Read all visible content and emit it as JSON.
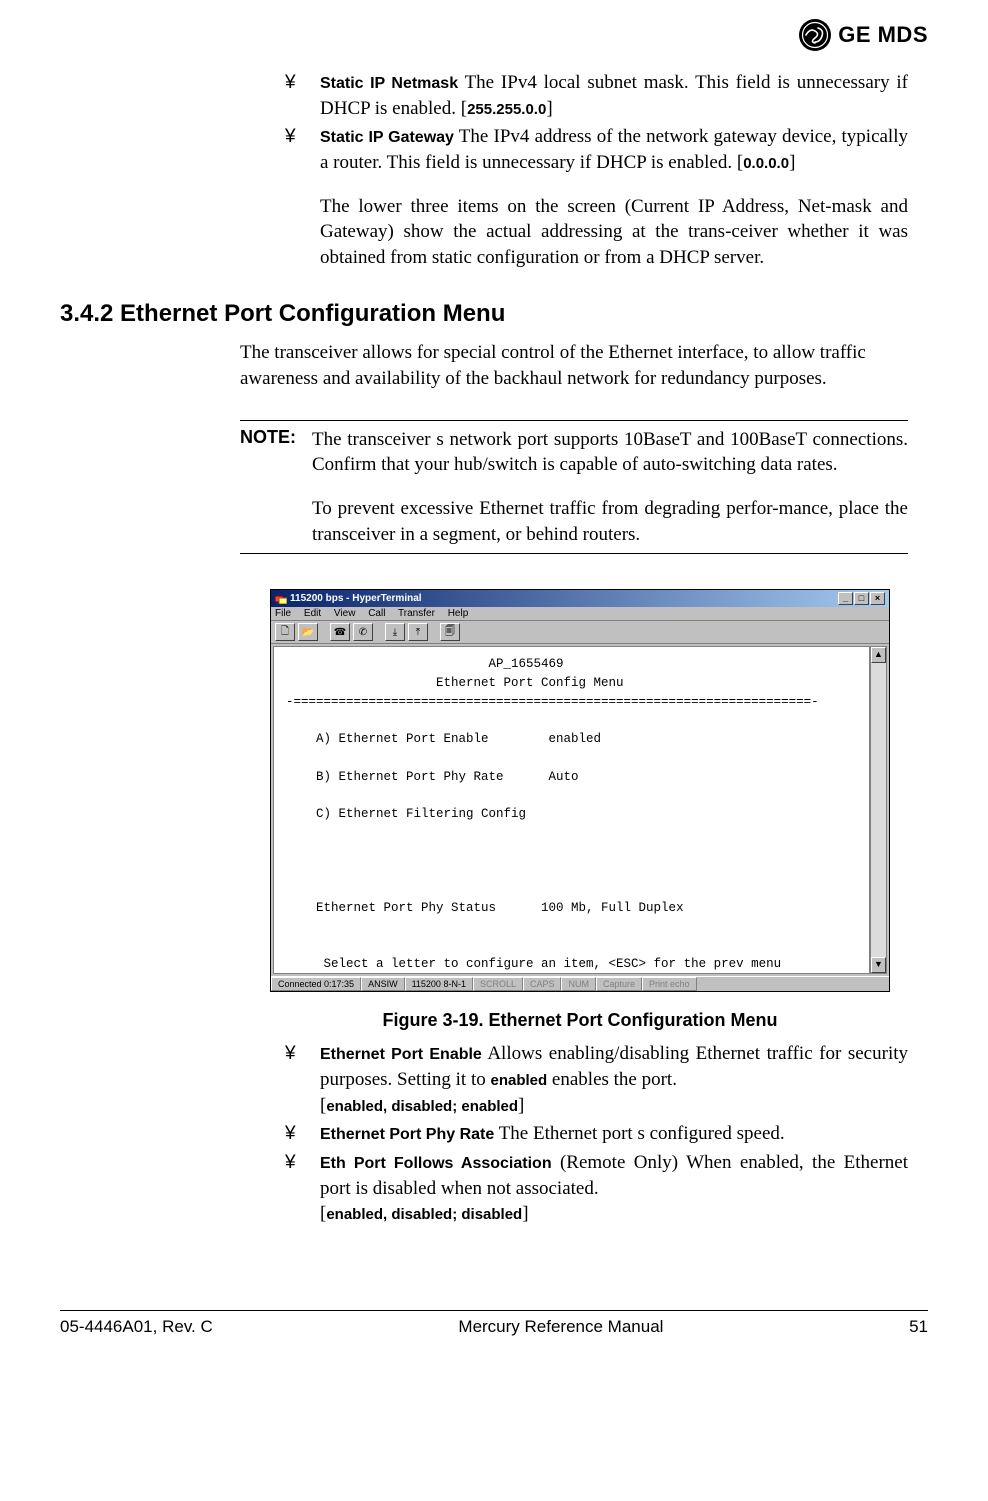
{
  "brand": {
    "name": "GE MDS"
  },
  "bullets_top": [
    {
      "term": "Static IP Netmask",
      "desc_a": "The IPv4 local subnet mask. This field is unnecessary if DHCP is enabled. [",
      "val": "255.255.0.0",
      "desc_b": "]"
    },
    {
      "term": "Static IP Gateway",
      "desc_a": "The IPv4 address of the network gateway device, typically a router. This field is unnecessary if DHCP is enabled. [",
      "val": "0.0.0.0",
      "desc_b": "]"
    }
  ],
  "follow_para": "The lower three items on the screen (Current IP Address, Net-mask and Gateway) show the actual addressing at the trans-ceiver whether it was obtained from static configuration or from a DHCP server.",
  "section_heading": "3.4.2 Ethernet Port Configuration Menu",
  "section_para": "The transceiver allows for special control of the Ethernet interface, to allow traffic awareness and availability of the backhaul network for redundancy purposes.",
  "note": {
    "label": "NOTE:",
    "p1": "The transceiver s network port supports 10BaseT and 100BaseT connections. Confirm that your hub/switch is capable of auto-switching data rates.",
    "p2": "To prevent excessive Ethernet traffic from degrading perfor-mance, place the transceiver in a segment, or behind routers."
  },
  "hyperterminal": {
    "title": "115200 bps - HyperTerminal",
    "menu": {
      "file": "File",
      "edit": "Edit",
      "view": "View",
      "call": "Call",
      "transfer": "Transfer",
      "help": "Help"
    },
    "terminal": {
      "header1": "                           AP_1655469",
      "header2": "                    Ethernet Port Config Menu",
      "divider": "-=====================================================================-",
      "blank": " ",
      "rowA": "    A) Ethernet Port Enable        enabled",
      "rowB": "    B) Ethernet Port Phy Rate      Auto",
      "rowC": "    C) Ethernet Filtering Config",
      "phy": "    Ethernet Port Phy Status      100 Mb, Full Duplex",
      "prompt": "     Select a letter to configure an item, <ESC> for the prev menu"
    },
    "status": {
      "conn": "Connected 0:17:35",
      "emul": "ANSIW",
      "rate": "115200 8-N-1",
      "scroll": "SCROLL",
      "caps": "CAPS",
      "num": "NUM",
      "capture": "Capture",
      "echo": "Print echo"
    }
  },
  "figure_caption": "Figure 3-19. Ethernet Port Configuration Menu",
  "bullets_bottom": [
    {
      "term": "Ethernet Port Enable",
      "desc": "Allows enabling/disabling Ethernet traffic for security purposes. Setting it to ",
      "inline_term": "enabled",
      "desc2": " enables the port.",
      "opts": "[enabled, disabled; enabled]"
    },
    {
      "term": "Ethernet Port Phy Rate",
      "desc": "The Ethernet port s configured speed."
    },
    {
      "term": "Eth Port Follows Association",
      "paren": " (Remote Only)",
      "desc": "When enabled, the Ethernet port is disabled when not associated.",
      "opts": "[enabled, disabled; disabled]"
    }
  ],
  "footer": {
    "left": "05-4446A01, Rev. C",
    "center": "Mercury Reference Manual",
    "right": "51"
  }
}
